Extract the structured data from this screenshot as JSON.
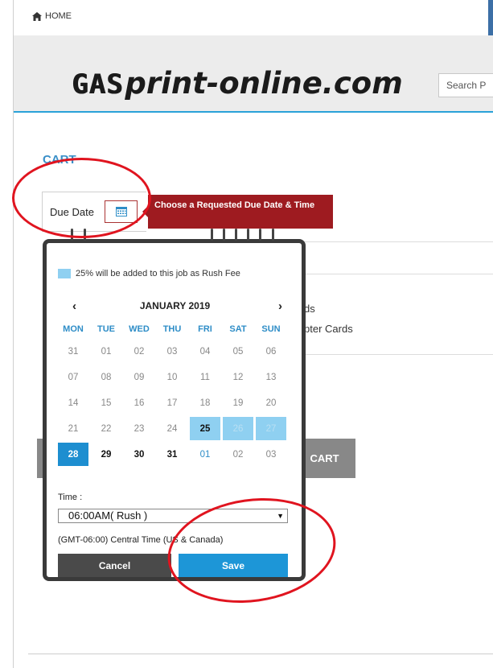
{
  "nav": {
    "home_label": "HOME"
  },
  "header": {
    "logo_gas": "GAS",
    "logo_rest": "print-online.com",
    "search_placeholder": "Search P"
  },
  "cart": {
    "title": "CART",
    "due_date_label": "Due Date",
    "tooltip": "Choose a Requested Due Date & Time",
    "bg_items": [
      "ds",
      "pter Cards"
    ],
    "bg_button": "CART"
  },
  "calendar": {
    "rush_note": "25% will be added to this job as Rush Fee",
    "rush_color": "#8fd0f1",
    "prev": "‹",
    "next": "›",
    "month": "JANUARY 2019",
    "weekdays": [
      "MON",
      "TUE",
      "WED",
      "THU",
      "FRI",
      "SAT",
      "SUN"
    ],
    "weeks": [
      [
        "31",
        "01",
        "02",
        "03",
        "04",
        "05",
        "06"
      ],
      [
        "07",
        "08",
        "09",
        "10",
        "11",
        "12",
        "13"
      ],
      [
        "14",
        "15",
        "16",
        "17",
        "18",
        "19",
        "20"
      ],
      [
        "21",
        "22",
        "23",
        "24",
        "25",
        "26",
        "27"
      ],
      [
        "28",
        "29",
        "30",
        "31",
        "01",
        "02",
        "03"
      ]
    ],
    "time_label": "Time :",
    "time_value": "06:00AM( Rush )",
    "timezone": "(GMT-06:00) Central Time (US & Canada)",
    "cancel_label": "Cancel",
    "save_label": "Save",
    "accent_color": "#1d96d7"
  }
}
